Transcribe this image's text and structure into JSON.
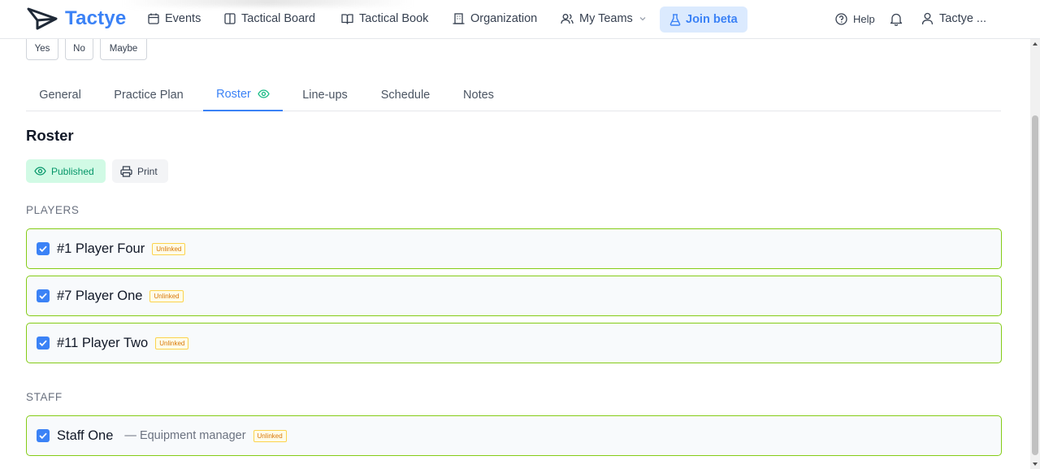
{
  "app": {
    "name": "Tactye",
    "brand_color": "#3b82f6"
  },
  "nav": {
    "events": "Events",
    "tactical_board": "Tactical Board",
    "tactical_book": "Tactical Book",
    "organization": "Organization",
    "my_teams": "My Teams",
    "join_beta": "Join beta",
    "help": "Help",
    "user": "Tactye ..."
  },
  "response": {
    "yes": "Yes",
    "no": "No",
    "maybe": "Maybe"
  },
  "tabs": [
    {
      "label": "General"
    },
    {
      "label": "Practice Plan"
    },
    {
      "label": "Roster",
      "active": true
    },
    {
      "label": "Line-ups"
    },
    {
      "label": "Schedule"
    },
    {
      "label": "Notes"
    }
  ],
  "roster": {
    "title": "Roster",
    "published_label": "Published",
    "print_label": "Print",
    "players_heading": "PLAYERS",
    "staff_heading": "STAFF",
    "players": [
      {
        "name": "#1 Player Four",
        "badge": "Unlinked",
        "checked": true
      },
      {
        "name": "#7 Player One",
        "badge": "Unlinked",
        "checked": true
      },
      {
        "name": "#11 Player Two",
        "badge": "Unlinked",
        "checked": true
      }
    ],
    "staff": [
      {
        "name": "Staff One",
        "role": "— Equipment manager",
        "badge": "Unlinked",
        "checked": true
      }
    ]
  },
  "colors": {
    "accent": "#3b82f6",
    "published_bg": "#d1fae5",
    "published_text": "#059669",
    "row_border": "#84cc16",
    "badge_text": "#d97706"
  }
}
